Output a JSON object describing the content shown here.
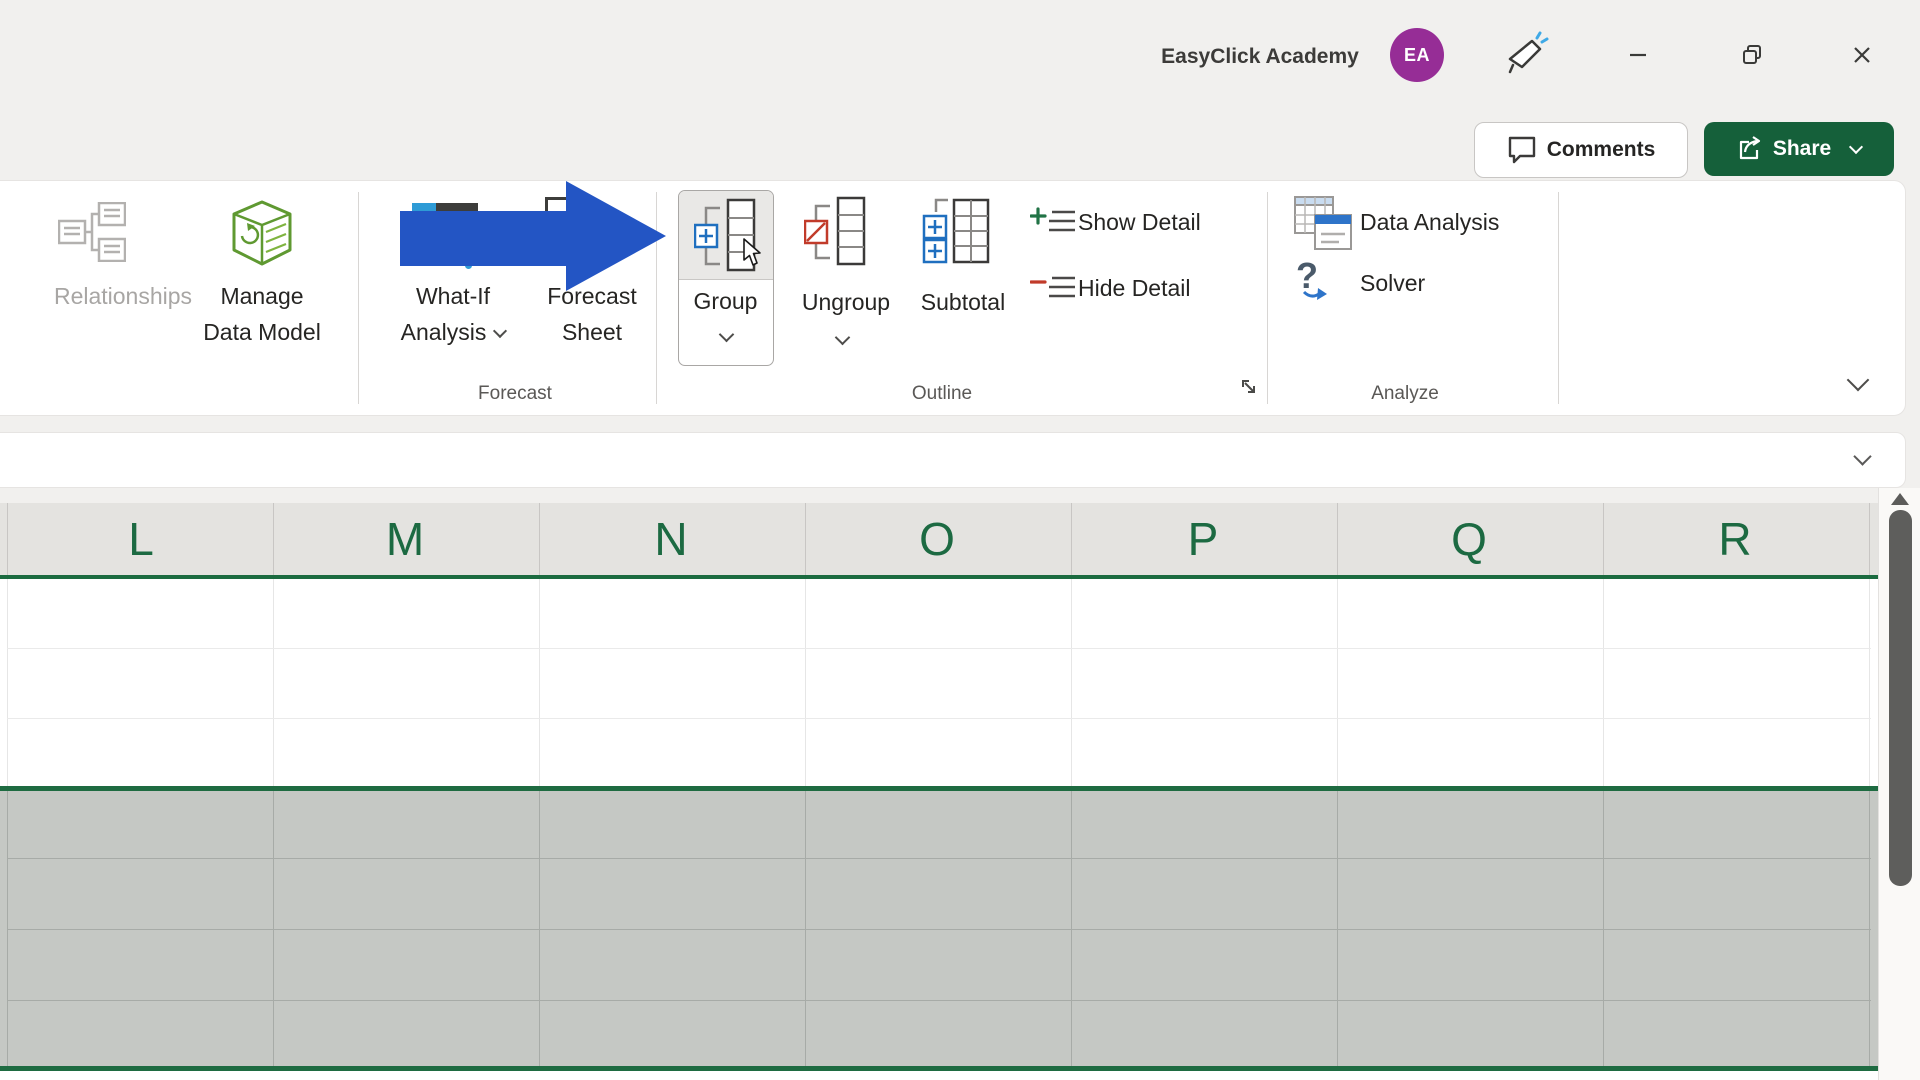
{
  "titlebar": {
    "account_name": "EasyClick Academy",
    "avatar_initials": "EA"
  },
  "actions": {
    "comments": "Comments",
    "share": "Share"
  },
  "ribbon": {
    "relationships": "Relationships",
    "manage_data_model": [
      "Manage",
      "Data Model"
    ],
    "what_if": [
      "What-If",
      "Analysis"
    ],
    "forecast_sheet": [
      "Forecast",
      "Sheet"
    ],
    "group": "Group",
    "ungroup": "Ungroup",
    "subtotal": "Subtotal",
    "show_detail": "Show Detail",
    "hide_detail": "Hide Detail",
    "data_analysis": "Data Analysis",
    "solver": "Solver",
    "groups": {
      "forecast": "Forecast",
      "outline": "Outline",
      "analyze": "Analyze"
    }
  },
  "grid": {
    "column_headers": [
      "L",
      "M",
      "N",
      "O",
      "P",
      "Q",
      "R"
    ]
  },
  "colors": {
    "excel_green": "#1E6B41",
    "share_button_green": "#15603A",
    "annotation_arrow_blue": "#2355C4",
    "avatar_purple": "#962D96",
    "selection_fill": "#C5C8C4"
  }
}
